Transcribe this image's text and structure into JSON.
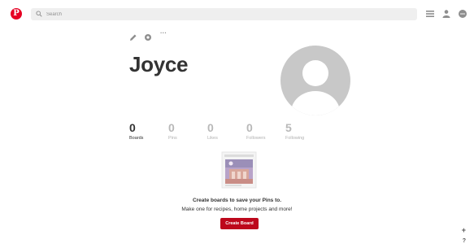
{
  "header": {
    "logo_letter": "P",
    "search_placeholder": "Search",
    "icons": [
      "pinterest-logo-icon",
      "search-icon",
      "menu-icon",
      "profile-icon",
      "messages-icon"
    ]
  },
  "profile": {
    "tool_icons": [
      "edit-pencil-icon",
      "settings-gear-icon",
      "more-dots-icon"
    ],
    "more_label": "···",
    "name": "Joyce",
    "stats": [
      {
        "value": "0",
        "label": "Boards",
        "active": true
      },
      {
        "value": "0",
        "label": "Pins",
        "active": false
      },
      {
        "value": "0",
        "label": "Likes",
        "active": false
      },
      {
        "value": "0",
        "label": "Followers",
        "active": false
      },
      {
        "value": "5",
        "label": "Following",
        "active": false
      }
    ]
  },
  "empty_state": {
    "title": "Create boards to save your Pins to.",
    "subtitle": "Make one for recipes, home projects and more!",
    "button_label": "Create Board"
  },
  "corner": {
    "add_label": "+",
    "help_label": "?"
  },
  "colors": {
    "brand_red": "#e60023",
    "button_red": "#bd081c",
    "avatar_gray": "#c8c8c8"
  }
}
